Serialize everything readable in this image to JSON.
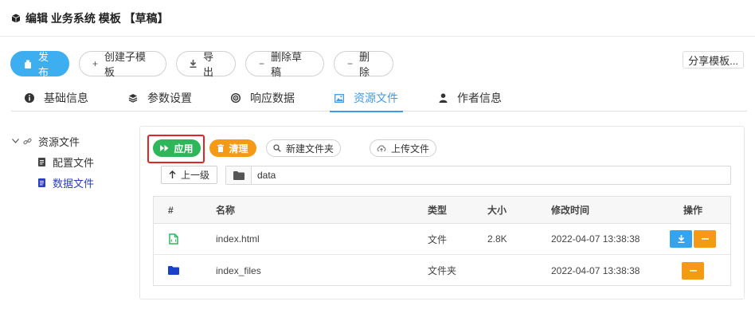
{
  "header": {
    "title": "编辑 业务系统 模板 【草稿】"
  },
  "toolbar": {
    "publish": "发布",
    "create_child": "创建子模板",
    "export": "导出",
    "delete_draft": "删除草稿",
    "delete": "删除",
    "share": "分享模板..."
  },
  "tabs": [
    {
      "label": "基础信息",
      "icon": "info-icon"
    },
    {
      "label": "参数设置",
      "icon": "layers-icon"
    },
    {
      "label": "响应数据",
      "icon": "target-icon"
    },
    {
      "label": "资源文件",
      "icon": "image-icon",
      "active": true
    },
    {
      "label": "作者信息",
      "icon": "user-icon"
    }
  ],
  "tree": {
    "root": "资源文件",
    "children": [
      "配置文件",
      "数据文件"
    ],
    "selected": "数据文件"
  },
  "file_actions": {
    "apply": "应用",
    "clear": "清理",
    "new_folder": "新建文件夹",
    "upload": "上传文件",
    "up_level": "上一级",
    "path": "data"
  },
  "table": {
    "columns": [
      "#",
      "名称",
      "类型",
      "大小",
      "修改时间",
      "操作"
    ],
    "rows": [
      {
        "icon": "html-file-icon",
        "name": "index.html",
        "type": "文件",
        "size": "2.8K",
        "modified": "2022-04-07 13:38:38"
      },
      {
        "icon": "folder-icon",
        "name": "index_files",
        "type": "文件夹",
        "size": "",
        "modified": "2022-04-07 13:38:38"
      }
    ]
  },
  "colors": {
    "primary": "#3daef0",
    "tab_active": "#3d9be9",
    "apply_green": "#2fb55a",
    "clear_orange": "#f59a16",
    "highlight_red": "#e02525",
    "tree_selected": "#2a3fbf"
  }
}
